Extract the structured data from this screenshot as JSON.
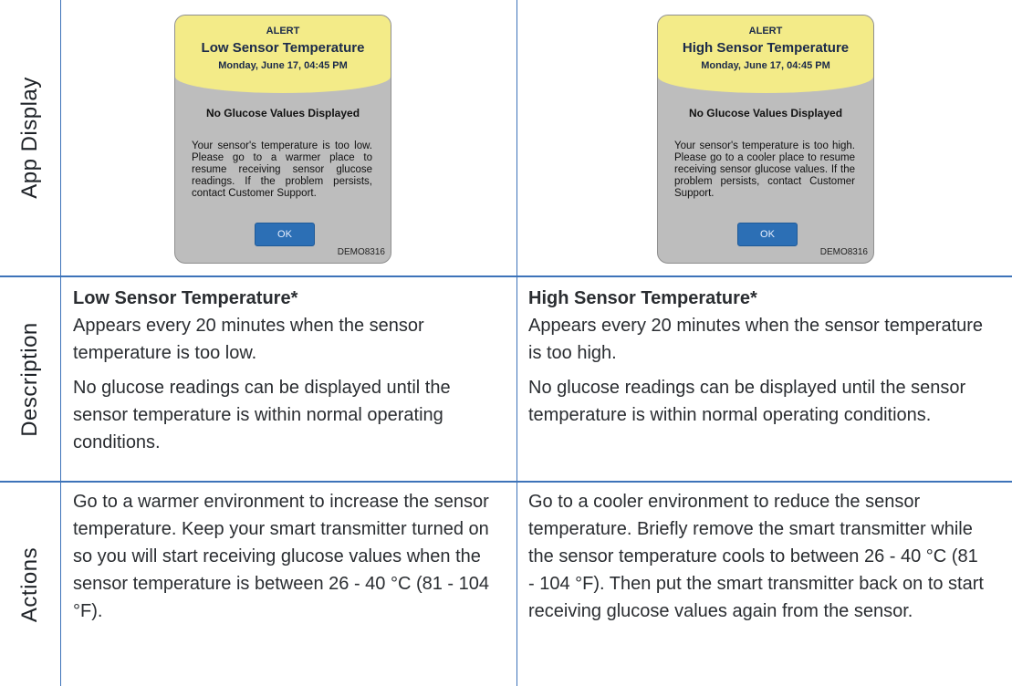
{
  "row_labels": {
    "app_display": "App Display",
    "description": "Description",
    "actions": "Actions"
  },
  "low": {
    "alert": {
      "label": "ALERT",
      "title": "Low Sensor Temperature",
      "date": "Monday, June 17, 04:45 PM",
      "subtitle": "No Glucose Values Displayed",
      "message": "Your sensor's temperature is too low. Please go to a warmer place to resume receiving sensor glucose readings. If the problem persists, contact Customer Support.",
      "ok_label": "OK",
      "id": "DEMO8316"
    },
    "description_title": "Low Sensor Temperature*",
    "description_p1": "Appears every 20 minutes when the sensor temperature is too low.",
    "description_p2": "No glucose readings can be displayed until the sensor temperature is within normal operating conditions.",
    "actions": "Go to a warmer environment to increase the sensor temperature. Keep your smart transmitter turned on so you will start receiving glucose values when the sensor temperature is between 26 - 40 °C (81 - 104 °F)."
  },
  "high": {
    "alert": {
      "label": "ALERT",
      "title": "High Sensor Temperature",
      "date": "Monday, June 17, 04:45 PM",
      "subtitle": "No Glucose Values Displayed",
      "message": "Your sensor's temperature is too high. Please go to a cooler place to resume receiving sensor glucose values. If the problem persists, contact Customer Support.",
      "ok_label": "OK",
      "id": "DEMO8316"
    },
    "description_title": "High Sensor Temperature*",
    "description_p1": "Appears every 20 minutes when the sensor temperature is too high.",
    "description_p2": "No glucose readings can be displayed until the sensor temperature is within normal operating conditions.",
    "actions": "Go to a cooler environment to reduce the sensor temperature. Briefly remove the smart transmitter while the sensor temperature cools to between 26 - 40 °C (81 - 104 °F). Then put the smart transmitter back on to start receiving glucose values again from the sensor."
  }
}
